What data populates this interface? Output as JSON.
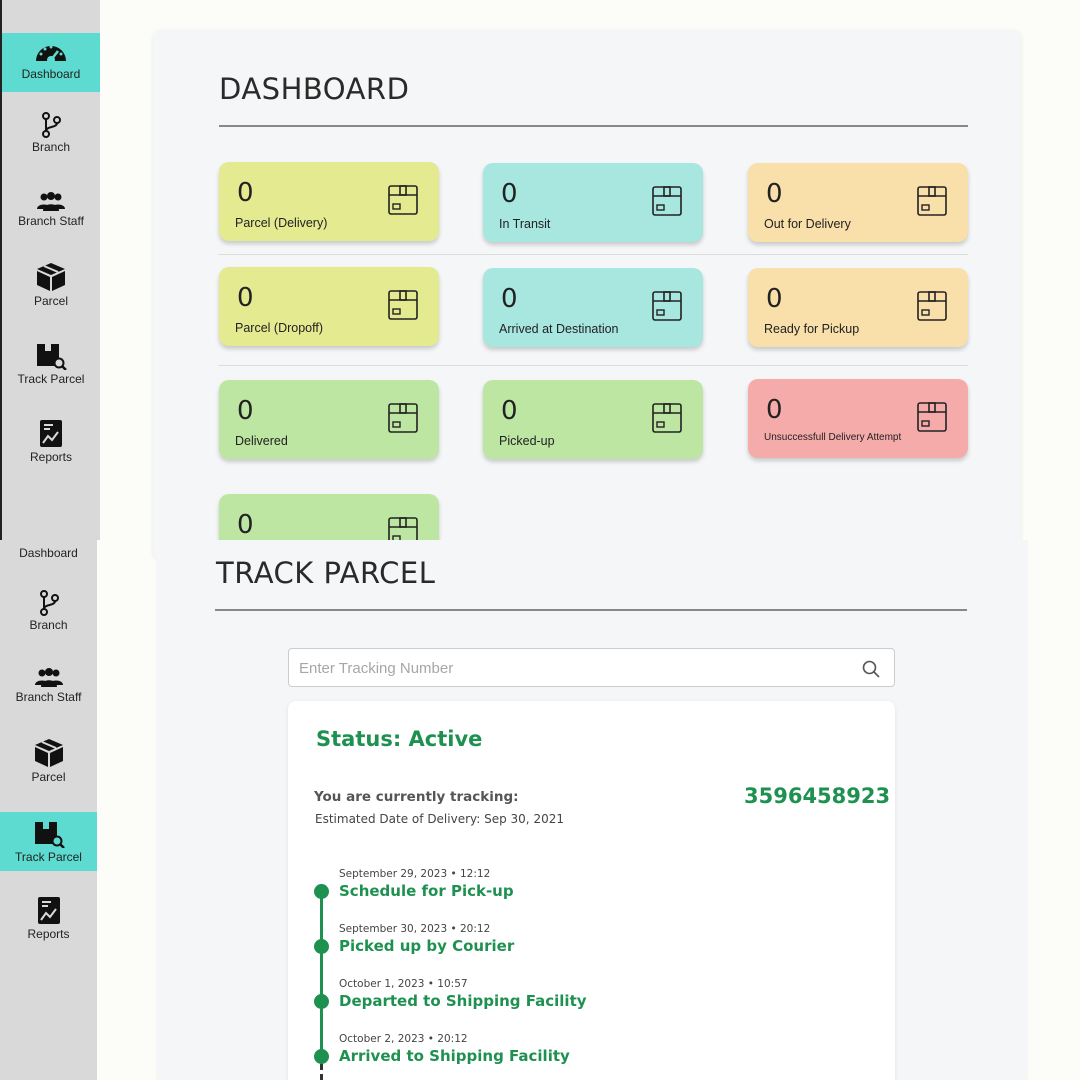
{
  "sidebar": {
    "items": [
      {
        "label": "Dashboard",
        "icon": "dashboard-gauge-icon"
      },
      {
        "label": "Branch",
        "icon": "branch-icon"
      },
      {
        "label": "Branch Staff",
        "icon": "staff-group-icon"
      },
      {
        "label": "Parcel",
        "icon": "parcel-box-icon"
      },
      {
        "label": "Track Parcel",
        "icon": "track-parcel-icon"
      },
      {
        "label": "Reports",
        "icon": "reports-icon"
      }
    ],
    "active_color": "#5ddbd0"
  },
  "dashboard": {
    "title": "DASHBOARD",
    "cards": [
      {
        "value": "0",
        "label": "Parcel (Delivery)",
        "color": "#e3ea8f"
      },
      {
        "value": "0",
        "label": "In Transit",
        "color": "#a8e6e0"
      },
      {
        "value": "0",
        "label": "Out for Delivery",
        "color": "#f9dfaa"
      },
      {
        "value": "0",
        "label": "Parcel (Dropoff)",
        "color": "#e3ea8f"
      },
      {
        "value": "0",
        "label": "Arrived at Destination",
        "color": "#a8e6e0"
      },
      {
        "value": "0",
        "label": "Ready for Pickup",
        "color": "#f9dfaa"
      },
      {
        "value": "0",
        "label": "Delivered",
        "color": "#bde6a3"
      },
      {
        "value": "0",
        "label": "Picked-up",
        "color": "#bde6a3"
      },
      {
        "value": "0",
        "label": "Unsuccessfull Delivery Attempt",
        "color": "#f6abab"
      },
      {
        "value": "0",
        "label": "",
        "color": "#bde6a3"
      }
    ]
  },
  "track": {
    "title": "TRACK PARCEL",
    "search": {
      "placeholder": "Enter Tracking Number",
      "icon": "search-icon"
    },
    "status": "Status: Active",
    "tracking_label": "You are currently tracking:",
    "eta": "Estimated Date of Delivery: Sep 30, 2021",
    "tracking_number": "3596458923",
    "accent": "#1e9150",
    "timeline": [
      {
        "date": "September 29, 2023 • 12:12",
        "event": "Schedule for Pick-up"
      },
      {
        "date": "September 30, 2023 • 20:12",
        "event": "Picked up by Courier"
      },
      {
        "date": "October 1, 2023 • 10:57",
        "event": "Departed to Shipping Facility"
      },
      {
        "date": "October 2, 2023 • 20:12",
        "event": "Arrived to Shipping Facility"
      }
    ]
  }
}
